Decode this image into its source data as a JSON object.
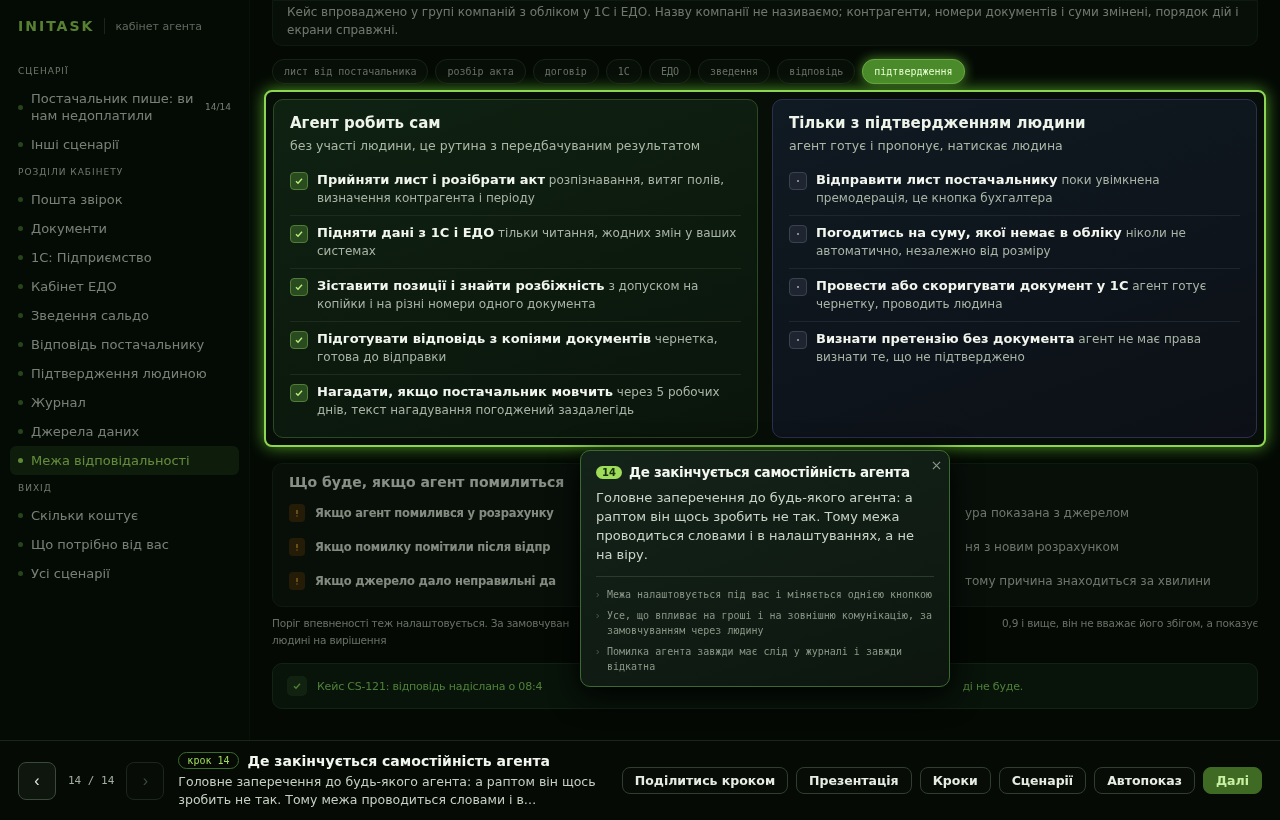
{
  "brand": {
    "logo": "INITASK",
    "subtitle": "кабінет агента"
  },
  "sidebar": {
    "sections": [
      {
        "heading": "СЦЕНАРІЇ",
        "items": [
          {
            "label": "Постачальник пише: ви нам недоплатили",
            "count": "14/14",
            "selected": false
          },
          {
            "label": "Інші сценарії",
            "selected": false
          }
        ]
      },
      {
        "heading": "РОЗДІЛИ КАБІНЕТУ",
        "items": [
          {
            "label": "Пошта звірок",
            "selected": false
          },
          {
            "label": "Документи",
            "selected": false
          },
          {
            "label": "1С: Підприємство",
            "selected": false
          },
          {
            "label": "Кабінет ЕДО",
            "selected": false
          },
          {
            "label": "Зведення сальдо",
            "selected": false
          },
          {
            "label": "Відповідь постачальнику",
            "selected": false
          },
          {
            "label": "Підтвердження людиною",
            "selected": false
          },
          {
            "label": "Журнал",
            "selected": false
          },
          {
            "label": "Джерела даних",
            "selected": false
          },
          {
            "label": "Межа відповідальності",
            "selected": true
          }
        ]
      },
      {
        "heading": "ВИХІД",
        "items": [
          {
            "label": "Скільки коштує",
            "selected": false
          },
          {
            "label": "Що потрібно від вас",
            "selected": false
          },
          {
            "label": "Усі сценарії",
            "selected": false
          }
        ]
      }
    ]
  },
  "intro": "Кейс впроваджено у групі компаній з обліком у 1С і ЕДО. Назву компанії не називаємо; контрагенти, номери документів і суми змінені, порядок дій і екрани справжні.",
  "chips": [
    {
      "label": "лист від постачальника",
      "selected": false
    },
    {
      "label": "розбір акта",
      "selected": false
    },
    {
      "label": "договір",
      "selected": false
    },
    {
      "label": "1С",
      "selected": false
    },
    {
      "label": "ЕДО",
      "selected": false
    },
    {
      "label": "зведення",
      "selected": false
    },
    {
      "label": "відповідь",
      "selected": false
    },
    {
      "label": "підтвердження",
      "selected": true
    }
  ],
  "autonomy": {
    "columns": [
      {
        "kind": "auto",
        "title": "Агент робить сам",
        "subtitle": "без участі людини, це рутина з передбачуваним результатом",
        "items": [
          "**Прийняти лист і розібрати акт** розпізнавання, витяг полів, визначення контрагента і періоду",
          "**Підняти дані з 1С і ЕДО** тільки читання, жодних змін у ваших системах",
          "**Зіставити позиції і знайти розбіжність** з допуском на копійки і на різні номери одного документа",
          "**Підготувати відповідь з копіями документів** чернетка, готова до відправки",
          "**Нагадати, якщо постачальник мовчить** через 5 робочих днів, текст нагадування погоджений заздалегідь"
        ]
      },
      {
        "kind": "human",
        "title": "Тільки з підтвердженням людини",
        "subtitle": "агент готує і пропонує, натискає людина",
        "items": [
          "**Відправити лист постачальнику** поки увімкнена премодерація, це кнопка бухгалтера",
          "**Погодитись на суму, якої немає в обліку** ніколи не автоматично, незалежно від розміру",
          "**Провести або скоригувати документ у 1С** агент готує чернетку, проводить людина",
          "**Визнати претензію без документа** агент не має права визнати те, що не підтверджено"
        ]
      }
    ]
  },
  "errors": {
    "title": "Що буде, якщо агент помилиться",
    "rows": [
      {
        "lead": "Якщо агент помилився у розрахунку",
        "tail": "ура показана з джерелом"
      },
      {
        "lead": "Якщо помилку помітили після відпр",
        "tail": "ня з новим розрахунком"
      },
      {
        "lead": "Якщо джерело дало неправильні да",
        "tail": "тому причина знаходиться за хвилини"
      }
    ]
  },
  "threshold_note": {
    "lead": "Поріг впевненості теж налаштовується. За замовчуван",
    "tail": "0,9 і вище, він не вважає його збігом, а показує",
    "continuation": "людині на вирішення"
  },
  "case_banner": {
    "lead": "Кейс CS-121: відповідь надіслана о 08:4",
    "tail": "ді не буде."
  },
  "popover": {
    "step": "14",
    "title": "Де закінчується самостійність агента",
    "body": "Головне заперечення до будь-якого агента: а раптом він щось зробить не так. Тому межа проводиться словами і в налаштуваннях, а не на віру.",
    "points": [
      "Межа налаштовується під вас і міняється однією кнопкою",
      "Усе, що впливає на гроші і на зовнішню комунікацію, за замовчуванням через людину",
      "Помилка агента завжди має слід у журналі і завжди відкатна"
    ]
  },
  "player": {
    "prev": {
      "glyph": "‹",
      "disabled": false
    },
    "position": "14 / 14",
    "next": {
      "glyph": "›",
      "disabled": true
    },
    "step_badge": "крок 14",
    "title": "Де закінчується самостійність агента",
    "summary": "Головне заперечення до будь-якого агента: а раптом він щось зробить не так. Тому межа проводиться словами і в…",
    "actions": [
      {
        "label": "Поділитись кроком",
        "primary": false
      },
      {
        "label": "Презентація",
        "primary": false
      },
      {
        "label": "Кроки",
        "primary": false
      },
      {
        "label": "Сценарії",
        "primary": false
      },
      {
        "label": "Автопоказ",
        "primary": false
      },
      {
        "label": "Далі",
        "primary": true
      }
    ]
  }
}
